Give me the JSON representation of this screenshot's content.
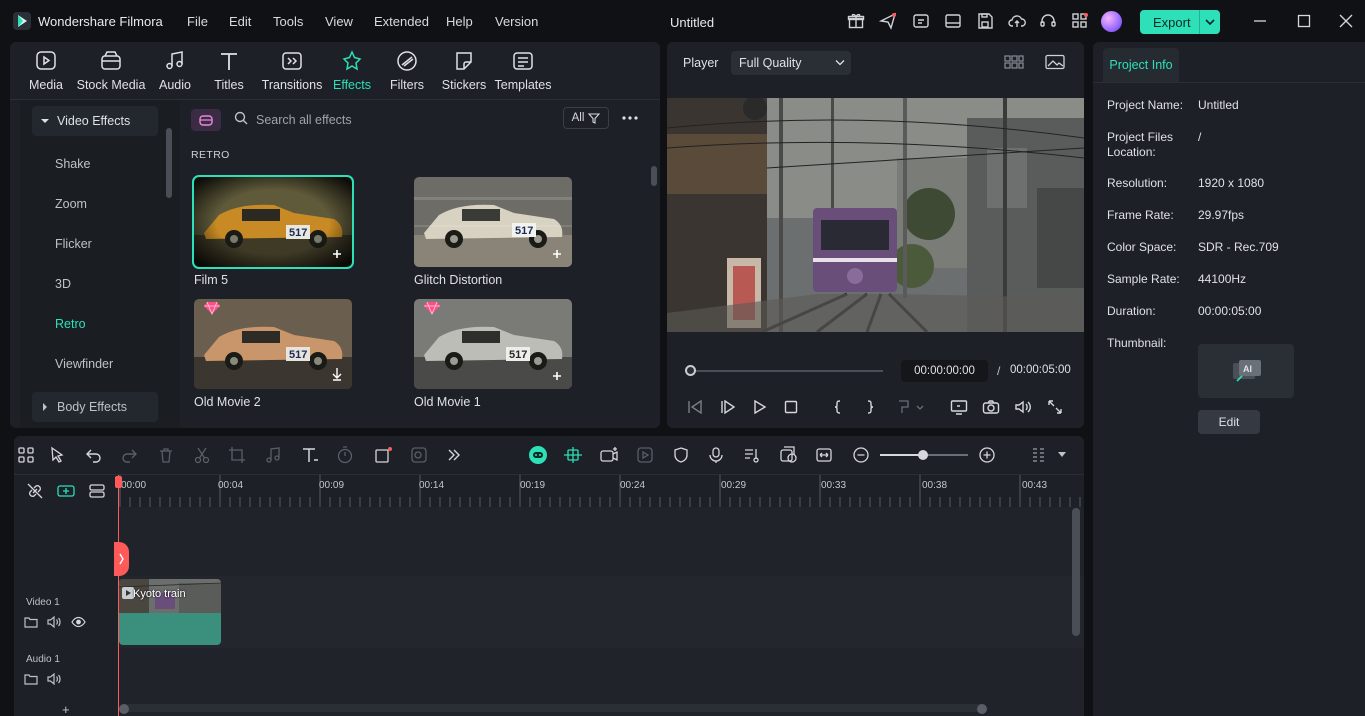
{
  "app": {
    "name": "Wondershare Filmora",
    "project_title": "Untitled",
    "menu": [
      "File",
      "Edit",
      "Tools",
      "View",
      "Extended",
      "Help",
      "Version"
    ],
    "export_label": "Export",
    "accent_color": "#2de0b8"
  },
  "media_tabs": [
    {
      "label": "Media",
      "icon": "media-icon"
    },
    {
      "label": "Stock Media",
      "icon": "stock-media-icon"
    },
    {
      "label": "Audio",
      "icon": "audio-icon"
    },
    {
      "label": "Titles",
      "icon": "titles-icon"
    },
    {
      "label": "Transitions",
      "icon": "transitions-icon"
    },
    {
      "label": "Effects",
      "icon": "effects-icon",
      "active": true
    },
    {
      "label": "Filters",
      "icon": "filters-icon"
    },
    {
      "label": "Stickers",
      "icon": "stickers-icon"
    },
    {
      "label": "Templates",
      "icon": "templates-icon"
    }
  ],
  "effects_nav": {
    "group_video": "Video Effects",
    "items": [
      "Shake",
      "Zoom",
      "Flicker",
      "3D",
      "Retro",
      "Viewfinder"
    ],
    "active": "Retro",
    "group_body": "Body Effects"
  },
  "effects": {
    "search_placeholder": "Search all effects",
    "filter_label": "All",
    "section_title": "RETRO",
    "items": [
      {
        "label": "Film 5",
        "selected": true,
        "premium": false,
        "action": "add"
      },
      {
        "label": "Glitch Distortion",
        "selected": false,
        "premium": false,
        "action": "add"
      },
      {
        "label": "Old Movie 2",
        "selected": false,
        "premium": true,
        "action": "download"
      },
      {
        "label": "Old Movie 1",
        "selected": false,
        "premium": true,
        "action": "add"
      }
    ]
  },
  "player": {
    "label": "Player",
    "quality": "Full Quality",
    "time_current": "00:00:00:00",
    "time_separator": "/",
    "time_total": "00:00:05:00",
    "progress": 0
  },
  "project_info": {
    "tab_label": "Project Info",
    "fields": [
      {
        "key": "Project Name:",
        "value": "Untitled"
      },
      {
        "key": "Project Files Location:",
        "value": "/"
      },
      {
        "key": "Resolution:",
        "value": "1920 x 1080"
      },
      {
        "key": "Frame Rate:",
        "value": "29.97fps"
      },
      {
        "key": "Color Space:",
        "value": "SDR - Rec.709"
      },
      {
        "key": "Sample Rate:",
        "value": "44100Hz"
      },
      {
        "key": "Duration:",
        "value": "00:00:05:00"
      }
    ],
    "thumbnail_label": "Thumbnail:",
    "edit_label": "Edit"
  },
  "timeline": {
    "ruler_ticks": [
      "00:00",
      "00:04",
      "00:09",
      "00:14",
      "00:19",
      "00:24",
      "00:29",
      "00:33",
      "00:38",
      "00:43"
    ],
    "tracks": [
      {
        "name": "Video 1"
      },
      {
        "name": "Audio 1"
      }
    ],
    "clip_label": "Kyoto train",
    "add_track_label": "+",
    "zoom_level": 0.48
  }
}
